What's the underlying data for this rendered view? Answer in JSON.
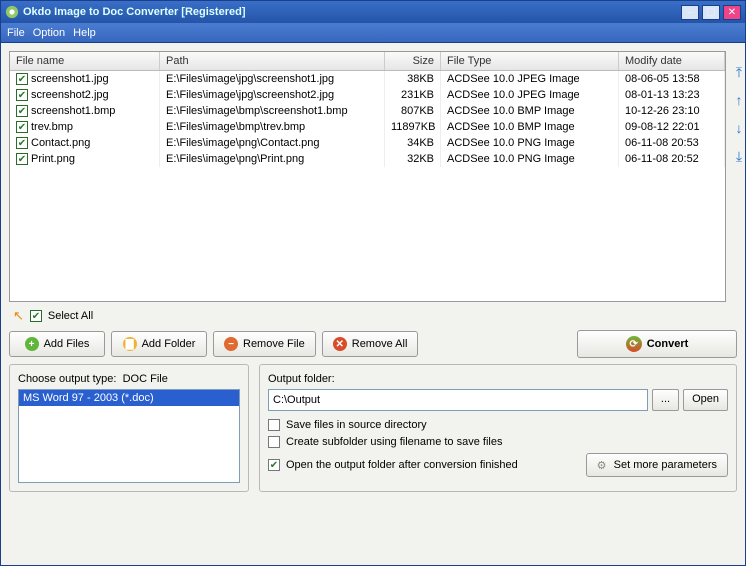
{
  "window": {
    "title": "Okdo Image to Doc Converter [Registered]"
  },
  "menu": {
    "file": "File",
    "option": "Option",
    "help": "Help"
  },
  "grid": {
    "headers": {
      "name": "File name",
      "path": "Path",
      "size": "Size",
      "type": "File Type",
      "date": "Modify date"
    },
    "rows": [
      {
        "checked": true,
        "name": "screenshot1.jpg",
        "path": "E:\\Files\\image\\jpg\\screenshot1.jpg",
        "size": "38KB",
        "type": "ACDSee 10.0 JPEG Image",
        "date": "08-06-05 13:58"
      },
      {
        "checked": true,
        "name": "screenshot2.jpg",
        "path": "E:\\Files\\image\\jpg\\screenshot2.jpg",
        "size": "231KB",
        "type": "ACDSee 10.0 JPEG Image",
        "date": "08-01-13 13:23"
      },
      {
        "checked": true,
        "name": "screenshot1.bmp",
        "path": "E:\\Files\\image\\bmp\\screenshot1.bmp",
        "size": "807KB",
        "type": "ACDSee 10.0 BMP Image",
        "date": "10-12-26 23:10"
      },
      {
        "checked": true,
        "name": "trev.bmp",
        "path": "E:\\Files\\image\\bmp\\trev.bmp",
        "size": "11897KB",
        "type": "ACDSee 10.0 BMP Image",
        "date": "09-08-12 22:01"
      },
      {
        "checked": true,
        "name": "Contact.png",
        "path": "E:\\Files\\image\\png\\Contact.png",
        "size": "34KB",
        "type": "ACDSee 10.0 PNG Image",
        "date": "06-11-08 20:53"
      },
      {
        "checked": true,
        "name": "Print.png",
        "path": "E:\\Files\\image\\png\\Print.png",
        "size": "32KB",
        "type": "ACDSee 10.0 PNG Image",
        "date": "06-11-08 20:52"
      }
    ]
  },
  "selectall": {
    "label": "Select All"
  },
  "buttons": {
    "add_files": "Add Files",
    "add_folder": "Add Folder",
    "remove_file": "Remove File",
    "remove_all": "Remove All",
    "convert": "Convert"
  },
  "output_type": {
    "label": "Choose output type:",
    "current": "DOC File",
    "options": [
      "MS Word 97 - 2003 (*.doc)"
    ]
  },
  "output_folder": {
    "label": "Output folder:",
    "value": "C:\\Output",
    "browse": "...",
    "open": "Open"
  },
  "options": {
    "save_source": {
      "label": "Save files in source directory",
      "checked": false
    },
    "subfolder": {
      "label": "Create subfolder using filename to save files",
      "checked": false
    },
    "open_after": {
      "label": "Open the output folder after conversion finished",
      "checked": true
    }
  },
  "more_params": "Set more parameters"
}
